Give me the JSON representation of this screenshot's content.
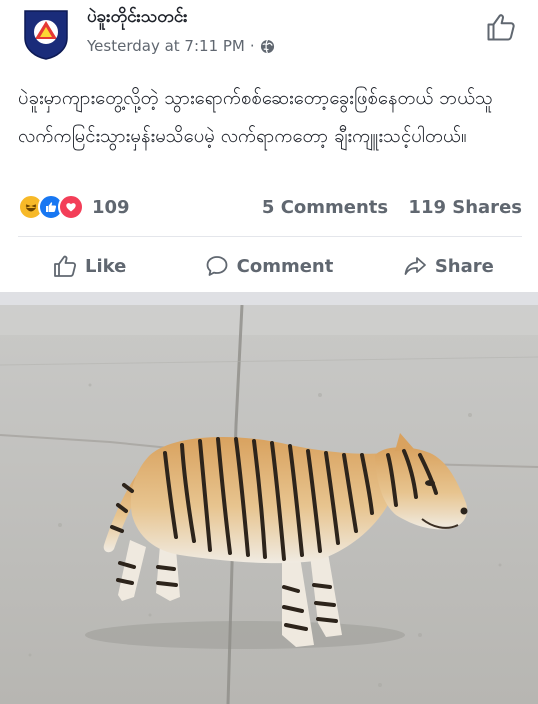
{
  "post": {
    "page_name": "ပဲခူးတိုင်းသတင်း",
    "timestamp": "Yesterday at 7:11 PM",
    "separator": "·",
    "privacy_icon": "globe-icon",
    "text": "ပဲခူးမှာကျားတွေ့လို့တဲ့ သွားရောက်စစ်ဆေးတော့ခွေးဖြစ်နေတယ် ဘယ်သူလက်ကမြင်းသွားမှန်းမသိပေမဲ့ လက်ရာကတော့ ချီးကျူးသင့်ပါတယ်။"
  },
  "reactions": {
    "icons": [
      "haha-icon",
      "like-icon",
      "love-icon"
    ],
    "count": "109",
    "comments": "5 Comments",
    "shares": "119 Shares"
  },
  "actions": {
    "like": "Like",
    "comment": "Comment",
    "share": "Share"
  },
  "colors": {
    "text": "#1d2129",
    "secondary": "#606770",
    "like_blue": "#1877f2",
    "love_red": "#f33e58",
    "haha_yellow": "#f7b928"
  }
}
